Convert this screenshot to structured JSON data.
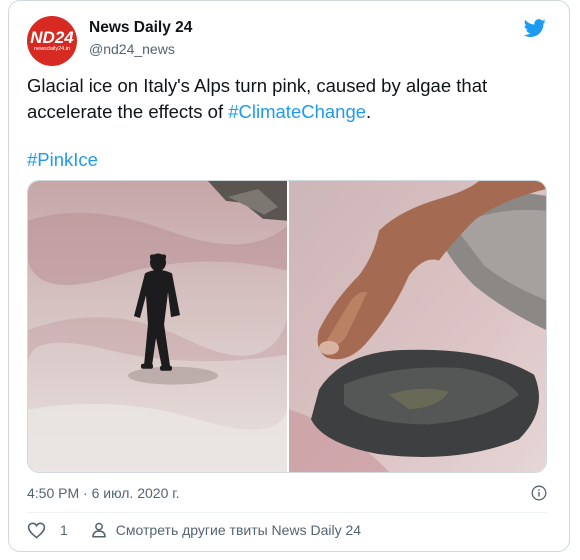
{
  "account": {
    "name": "News Daily 24",
    "handle": "@nd24_news",
    "avatar_text": "ND24",
    "avatar_subtext": "newsdaily24.in",
    "avatar_color": "#d72a23"
  },
  "tweet": {
    "text_main": "Glacial ice on Italy's Alps turn pink, caused by algae that accelerate the effects of ",
    "hashtag_1": "#ClimateChange",
    "text_after": ".",
    "hashtag_2": "#PinkIce",
    "timestamp": "4:50 PM · 6 июл. 2020 г."
  },
  "actions": {
    "like_count": "1",
    "more_tweets": "Смотреть другие твиты News Daily 24"
  },
  "icons": {
    "brand": "twitter-bird-icon",
    "info": "info-icon",
    "like": "heart-icon",
    "profile": "person-icon"
  },
  "colors": {
    "link": "#1d9bf0",
    "secondary_text": "#536471",
    "twitter_blue": "#1d9bf0"
  }
}
